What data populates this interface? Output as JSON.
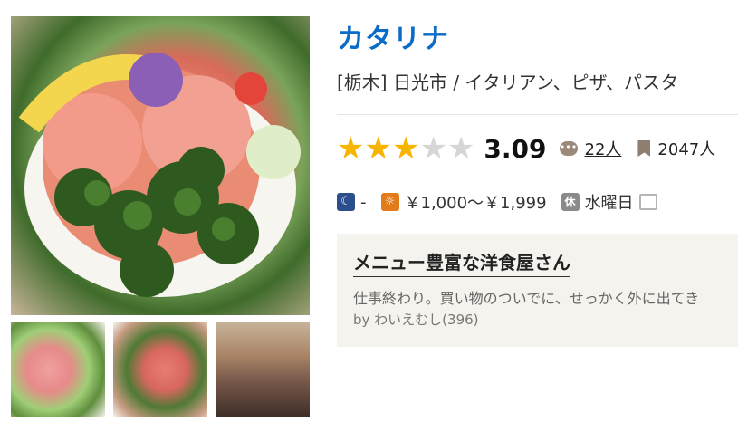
{
  "restaurant": {
    "name": "カタリナ",
    "area": "[栃木] 日光市 / イタリアン、ピザ、パスタ",
    "rating": "3.09",
    "stars_filled": 3,
    "stars_total": 5,
    "review_count": "22人",
    "save_count": "2047人"
  },
  "budget": {
    "night_label": "-",
    "day_label": "￥1,000～￥1,999"
  },
  "holiday": {
    "badge": "休",
    "text": "水曜日"
  },
  "icons": {
    "night": "moon-icon",
    "day": "sun-icon",
    "review": "speech-bubble-icon",
    "save": "bookmark-icon",
    "note": "note-icon"
  },
  "pr": {
    "title": "メニュー豊富な洋食屋さん",
    "text": "仕事終わり。買い物のついでに、せっかく外に出てき",
    "by": "by わいえむし(396)"
  },
  "colors": {
    "title": "#0a6cc7",
    "star": "#f7b500",
    "pr_bg": "#f5f3ee"
  }
}
